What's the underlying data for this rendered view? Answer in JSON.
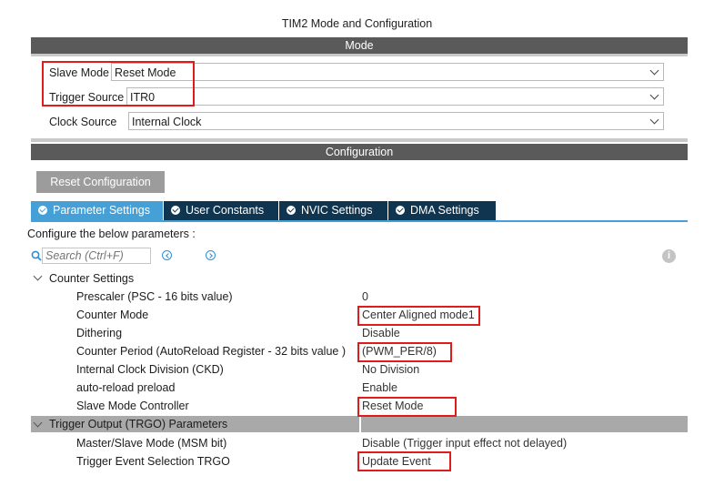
{
  "window_title": "TIM2 Mode and Configuration",
  "mode_section": {
    "header": "Mode",
    "fields": [
      {
        "label": "Slave Mode",
        "value": "Reset Mode"
      },
      {
        "label": "Trigger Source",
        "value": "ITR0"
      },
      {
        "label": "Clock Source",
        "value": "Internal Clock"
      }
    ]
  },
  "config_section": {
    "header": "Configuration",
    "reset_button": "Reset Configuration",
    "tabs": [
      {
        "label": "Parameter Settings",
        "active": true
      },
      {
        "label": "User Constants",
        "active": false
      },
      {
        "label": "NVIC Settings",
        "active": false
      },
      {
        "label": "DMA Settings",
        "active": false
      }
    ],
    "instructions": "Configure the below parameters :",
    "search_placeholder": "Search (Ctrl+F)"
  },
  "parameters": {
    "counter_settings": {
      "title": "Counter Settings",
      "items": [
        {
          "name": "Prescaler (PSC - 16 bits value)",
          "value": "0"
        },
        {
          "name": "Counter Mode",
          "value": "Center Aligned mode1"
        },
        {
          "name": "Dithering",
          "value": "Disable"
        },
        {
          "name": "Counter Period (AutoReload Register - 32 bits value )",
          "value": "(PWM_PER/8)"
        },
        {
          "name": "Internal Clock Division (CKD)",
          "value": "No Division"
        },
        {
          "name": "auto-reload preload",
          "value": "Enable"
        },
        {
          "name": "Slave Mode Controller",
          "value": "Reset Mode"
        }
      ]
    },
    "trgo": {
      "title": "Trigger Output (TRGO) Parameters",
      "items": [
        {
          "name": "Master/Slave Mode (MSM bit)",
          "value": "Disable (Trigger input effect not delayed)"
        },
        {
          "name": "Trigger Event Selection TRGO",
          "value": "Update Event"
        }
      ]
    }
  },
  "colors": {
    "header_bar": "#5a5a5a",
    "tab_active": "#45a0d8",
    "tab_inactive": "#0f3550",
    "highlight_box": "#e01b1b",
    "section_bar": "#a9a9a9"
  },
  "icons": [
    "chevron-down-icon",
    "check-circle-icon",
    "search-icon",
    "prev-match-icon",
    "next-match-icon",
    "info-icon",
    "collapse-chevron-icon"
  ]
}
